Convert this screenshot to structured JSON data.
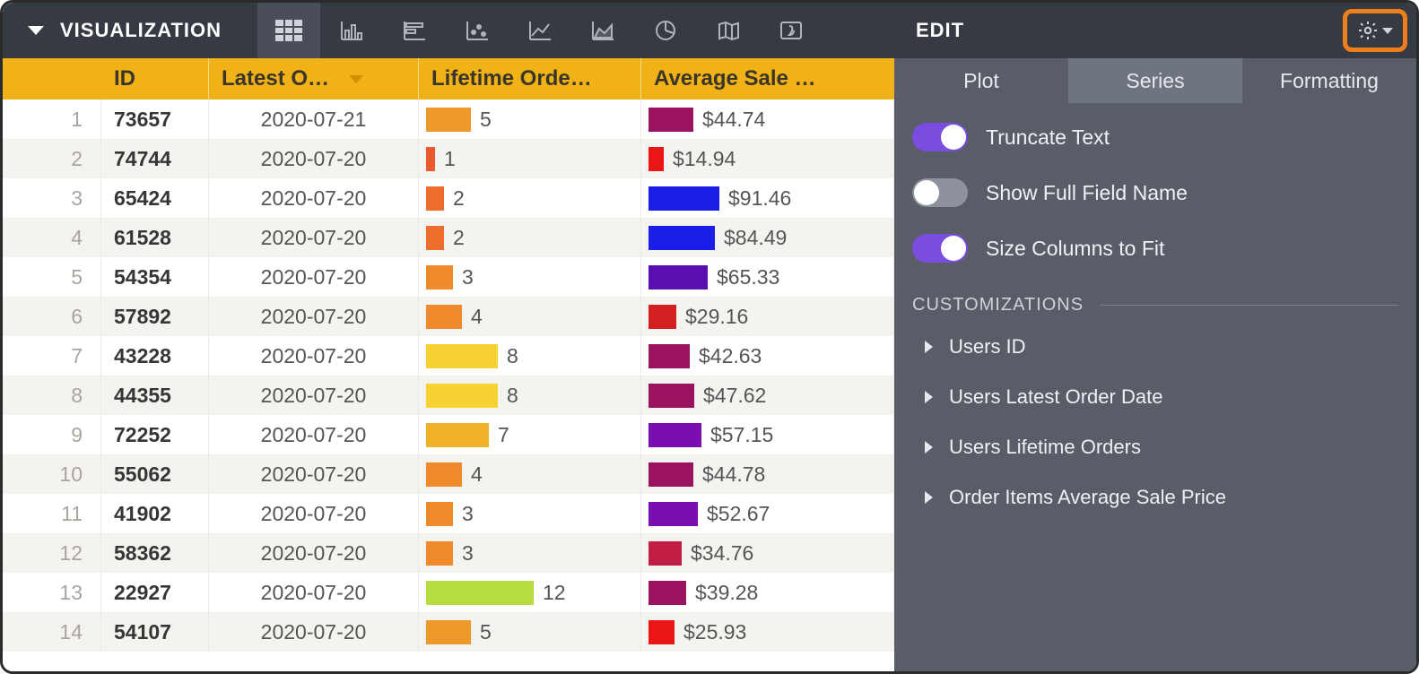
{
  "toolbar": {
    "title": "VISUALIZATION",
    "icons": [
      {
        "name": "table-icon",
        "active": true
      },
      {
        "name": "bar-chart-icon",
        "active": false
      },
      {
        "name": "horizontal-bar-icon",
        "active": false
      },
      {
        "name": "scatter-icon",
        "active": false
      },
      {
        "name": "line-chart-icon",
        "active": false
      },
      {
        "name": "area-chart-icon",
        "active": false
      },
      {
        "name": "pie-chart-icon",
        "active": false
      },
      {
        "name": "map-icon",
        "active": false
      },
      {
        "name": "single-value-icon",
        "active": false
      }
    ]
  },
  "table": {
    "headers": {
      "id": "ID",
      "date": "Latest O…",
      "orders": "Lifetime Orde…",
      "avg": "Average Sale …"
    },
    "ord_max": 12,
    "avg_max": 100,
    "rows": [
      {
        "n": 1,
        "id": "73657",
        "date": "2020-07-21",
        "orders": 5,
        "ord_color": "#ee9a2a",
        "avg": "$44.74",
        "avg_w": 45,
        "avg_color": "#9b1260"
      },
      {
        "n": 2,
        "id": "74744",
        "date": "2020-07-20",
        "orders": 1,
        "ord_color": "#eb5a2e",
        "avg": "$14.94",
        "avg_w": 15,
        "avg_color": "#eb1717"
      },
      {
        "n": 3,
        "id": "65424",
        "date": "2020-07-20",
        "orders": 2,
        "ord_color": "#ed6d2b",
        "avg": "$91.46",
        "avg_w": 72,
        "avg_color": "#1b1ee8"
      },
      {
        "n": 4,
        "id": "61528",
        "date": "2020-07-20",
        "orders": 2,
        "ord_color": "#ed6d2b",
        "avg": "$84.49",
        "avg_w": 67,
        "avg_color": "#1b1ee8"
      },
      {
        "n": 5,
        "id": "54354",
        "date": "2020-07-20",
        "orders": 3,
        "ord_color": "#f08a2c",
        "avg": "$65.33",
        "avg_w": 60,
        "avg_color": "#5b0fb0"
      },
      {
        "n": 6,
        "id": "57892",
        "date": "2020-07-20",
        "orders": 4,
        "ord_color": "#f08a2c",
        "avg": "$29.16",
        "avg_w": 28,
        "avg_color": "#d21f1f"
      },
      {
        "n": 7,
        "id": "43228",
        "date": "2020-07-20",
        "orders": 8,
        "ord_color": "#f6d233",
        "avg": "$42.63",
        "avg_w": 42,
        "avg_color": "#9b1260"
      },
      {
        "n": 8,
        "id": "44355",
        "date": "2020-07-20",
        "orders": 8,
        "ord_color": "#f6d233",
        "avg": "$47.62",
        "avg_w": 46,
        "avg_color": "#9b1260"
      },
      {
        "n": 9,
        "id": "72252",
        "date": "2020-07-20",
        "orders": 7,
        "ord_color": "#f0b22b",
        "avg": "$57.15",
        "avg_w": 54,
        "avg_color": "#7a0eb0"
      },
      {
        "n": 10,
        "id": "55062",
        "date": "2020-07-20",
        "orders": 4,
        "ord_color": "#f08a2c",
        "avg": "$44.78",
        "avg_w": 45,
        "avg_color": "#9b1260"
      },
      {
        "n": 11,
        "id": "41902",
        "date": "2020-07-20",
        "orders": 3,
        "ord_color": "#f08a2c",
        "avg": "$52.67",
        "avg_w": 50,
        "avg_color": "#7a0eb0"
      },
      {
        "n": 12,
        "id": "58362",
        "date": "2020-07-20",
        "orders": 3,
        "ord_color": "#f08a2c",
        "avg": "$34.76",
        "avg_w": 34,
        "avg_color": "#c01e44"
      },
      {
        "n": 13,
        "id": "22927",
        "date": "2020-07-20",
        "orders": 12,
        "ord_color": "#b6dd40",
        "avg": "$39.28",
        "avg_w": 38,
        "avg_color": "#9b1260"
      },
      {
        "n": 14,
        "id": "54107",
        "date": "2020-07-20",
        "orders": 5,
        "ord_color": "#ee9a2a",
        "avg": "$25.93",
        "avg_w": 26,
        "avg_color": "#eb1717"
      }
    ]
  },
  "edit": {
    "title": "EDIT",
    "tabs": [
      {
        "label": "Plot",
        "active": false
      },
      {
        "label": "Series",
        "active": true
      },
      {
        "label": "Formatting",
        "active": false
      }
    ],
    "toggles": [
      {
        "label": "Truncate Text",
        "on": true,
        "name": "truncate-text-toggle"
      },
      {
        "label": "Show Full Field Name",
        "on": false,
        "name": "show-full-field-name-toggle"
      },
      {
        "label": "Size Columns to Fit",
        "on": true,
        "name": "size-columns-to-fit-toggle"
      }
    ],
    "customizations_label": "CUSTOMIZATIONS",
    "customizations": [
      "Users ID",
      "Users Latest Order Date",
      "Users Lifetime Orders",
      "Order Items Average Sale Price"
    ]
  }
}
